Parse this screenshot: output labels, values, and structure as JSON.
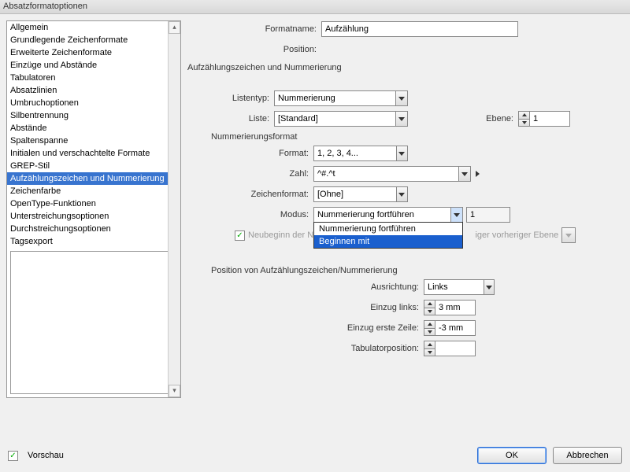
{
  "title": "Absatzformatoptionen",
  "sidebar": {
    "items": [
      {
        "label": "Allgemein"
      },
      {
        "label": "Grundlegende Zeichenformate"
      },
      {
        "label": "Erweiterte Zeichenformate"
      },
      {
        "label": "Einzüge und Abstände"
      },
      {
        "label": "Tabulatoren"
      },
      {
        "label": "Absatzlinien"
      },
      {
        "label": "Umbruchoptionen"
      },
      {
        "label": "Silbentrennung"
      },
      {
        "label": "Abstände"
      },
      {
        "label": "Spaltenspanne"
      },
      {
        "label": "Initialen und verschachtelte Formate"
      },
      {
        "label": "GREP-Stil"
      },
      {
        "label": "Aufzählungszeichen und Nummerierung"
      },
      {
        "label": "Zeichenfarbe"
      },
      {
        "label": "OpenType-Funktionen"
      },
      {
        "label": "Unterstreichungsoptionen"
      },
      {
        "label": "Durchstreichungsoptionen"
      },
      {
        "label": "Tagsexport"
      }
    ],
    "selected_index": 12
  },
  "header": {
    "formatname_label": "Formatname:",
    "formatname_value": "Aufzählung",
    "position_label": "Position:",
    "section_title": "Aufzählungszeichen und Nummerierung"
  },
  "list": {
    "listentyp_label": "Listentyp:",
    "listentyp_value": "Nummerierung",
    "liste_label": "Liste:",
    "liste_value": "[Standard]",
    "ebene_label": "Ebene:",
    "ebene_value": "1"
  },
  "numfmt": {
    "group_label": "Nummerierungsformat",
    "format_label": "Format:",
    "format_value": "1, 2, 3, 4...",
    "zahl_label": "Zahl:",
    "zahl_value": "^#.^t",
    "zeichenformat_label": "Zeichenformat:",
    "zeichenformat_value": "[Ohne]",
    "modus_label": "Modus:",
    "modus_value": "Nummerierung fortführen",
    "modus_dropdown": [
      "Nummerierung fortführen",
      "Beginnen mit"
    ],
    "modus_start_value": "1",
    "neubeginn_label_prefix": "Neubeginn der Num",
    "neubeginn_label_suffix": "iger vorheriger Ebene"
  },
  "pos": {
    "group_label": "Position von Aufzählungszeichen/Nummerierung",
    "ausrichtung_label": "Ausrichtung:",
    "ausrichtung_value": "Links",
    "einzug_links_label": "Einzug links:",
    "einzug_links_value": "3 mm",
    "einzug_erste_label": "Einzug erste Zeile:",
    "einzug_erste_value": "-3 mm",
    "tabulator_label": "Tabulatorposition:",
    "tabulator_value": ""
  },
  "footer": {
    "vorschau_label": "Vorschau",
    "ok": "OK",
    "cancel": "Abbrechen"
  }
}
